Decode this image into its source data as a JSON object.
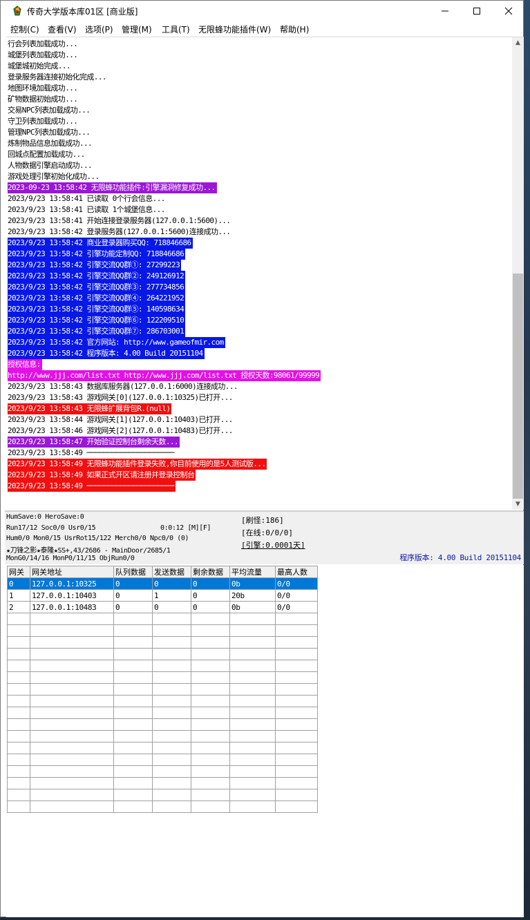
{
  "window": {
    "title": "传奇大学版本库01区 [商业版]",
    "accent": "#0078d7"
  },
  "menu": [
    "控制(C)",
    "查看(V)",
    "选项(P)",
    "管理(M)",
    "工具(T)",
    "无限蜂功能插件(W)",
    "帮助(H)"
  ],
  "log": [
    {
      "text": "行会列表加载成功...",
      "style": "normal"
    },
    {
      "text": "城堡列表加载成功...",
      "style": "normal"
    },
    {
      "text": "城堡城初始完成...",
      "style": "normal"
    },
    {
      "text": "登录服务器连接初始化完成...",
      "style": "normal"
    },
    {
      "text": "地图环境加载成功...",
      "style": "normal"
    },
    {
      "text": "矿物数据初始成功...",
      "style": "normal"
    },
    {
      "text": "交易NPC列表加载成功...",
      "style": "normal"
    },
    {
      "text": "守卫列表加载成功...",
      "style": "normal"
    },
    {
      "text": "管理NPC列表加载成功...",
      "style": "normal"
    },
    {
      "text": "炼制物品信息加载成功...",
      "style": "normal"
    },
    {
      "text": "回城点配置加载成功...",
      "style": "normal"
    },
    {
      "text": "人物数据引擎启动成功...",
      "style": "normal"
    },
    {
      "text": "游戏处理引擎初始化成功...",
      "style": "normal"
    },
    {
      "text": "2023-09-23 13:58:42 无限蜂功能插件:引擎漏洞修复成功...",
      "style": "purple"
    },
    {
      "text": "2023/9/23 13:58:41 已读取 0个行会信息...",
      "style": "normal"
    },
    {
      "text": "2023/9/23 13:58:41 已读取 1个城堡信息...",
      "style": "normal"
    },
    {
      "text": "2023/9/23 13:58:41 开始连接登录服务器(127.0.0.1:5600)...",
      "style": "normal"
    },
    {
      "text": "2023/9/23 13:58:42 登录服务器(127.0.0.1:5600)连接成功...",
      "style": "normal"
    },
    {
      "text": "2023/9/23 13:58:42 商业登录器购买QQ: 718846686",
      "style": "blue"
    },
    {
      "text": "2023/9/23 13:58:42 引擎功能定制QQ: 718846686",
      "style": "blue"
    },
    {
      "text": "2023/9/23 13:58:42 引擎交流QQ群①: 27299223",
      "style": "blue"
    },
    {
      "text": "2023/9/23 13:58:42 引擎交流QQ群②: 249126912",
      "style": "blue"
    },
    {
      "text": "2023/9/23 13:58:42 引擎交流QQ群③: 277734856",
      "style": "blue"
    },
    {
      "text": "2023/9/23 13:58:42 引擎交流QQ群④: 264221952",
      "style": "blue"
    },
    {
      "text": "2023/9/23 13:58:42 引擎交流QQ群⑤: 140598634",
      "style": "blue"
    },
    {
      "text": "2023/9/23 13:58:42 引擎交流QQ群⑥: 122209510",
      "style": "blue"
    },
    {
      "text": "2023/9/23 13:58:42 引擎交流QQ群⑦: 286703001",
      "style": "blue"
    },
    {
      "text": "2023/9/23 13:58:42 官方网站: http://www.gameofmir.com",
      "style": "blue"
    },
    {
      "text": "2023/9/23 13:58:42 程序版本: 4.00 Build 20151104",
      "style": "blue"
    },
    {
      "text": "授权信息:",
      "style": "magenta"
    },
    {
      "text": "http://www.jjj.com/list.txt http://www.jjj.com/list.txt 授权天数:98061/99999",
      "style": "magenta"
    },
    {
      "text": "2023/9/23 13:58:43 数据库服务器(127.0.0.1:6000)连接成功...",
      "style": "normal"
    },
    {
      "text": "2023/9/23 13:58:43 游戏网关[0](127.0.0.1:10325)已打开...",
      "style": "normal"
    },
    {
      "text": "2023/9/23 13:58:43 无限蜂扩展背包R.(null)",
      "style": "red"
    },
    {
      "text": "2023/9/23 13:58:44 游戏网关[1](127.0.0.1:10403)已打开...",
      "style": "normal"
    },
    {
      "text": "2023/9/23 13:58:46 游戏网关[2](127.0.0.1:10483)已打开...",
      "style": "normal"
    },
    {
      "text": "2023/9/23 13:58:47 开始验证控制台剩余天数...",
      "style": "purple"
    },
    {
      "text": "2023/9/23 13:58:49 ─────────────────────",
      "style": "normal"
    },
    {
      "text": "2023/9/23 13:58:49 无限蜂功能插件登录失败,你目前使用的是5人测试版...",
      "style": "red"
    },
    {
      "text": "2023/9/23 13:58:49 如果正式开区请注册并登录控制台",
      "style": "red"
    },
    {
      "text": "2023/9/23 13:58:49 ─────────────────────",
      "style": "red"
    }
  ],
  "status": {
    "line1": "HumSave:0 HeroSave:0",
    "line2": "Run17/12 Soc0/0 Usr0/15",
    "timer": "0:0:12 [M][F]",
    "line3": "Hum0/0 Mon0/15 UsrRot15/122 Merch0/0 Npc0/0 (0)",
    "line4": "★刀锋之影★泰隆★SS+,43/2686 - MainDoor/2685/1",
    "line5": "MonG0/14/16 MonP0/11/15 ObjRun0/0",
    "refresh": "[刷怪:186]",
    "online": "[在线:0/0/0]",
    "engine": "[引擎:0.0001天]",
    "version": "程序版本: 4.00 Build 20151104"
  },
  "gateway_table": {
    "headers": [
      "网关",
      "网关地址",
      "队列数据",
      "发送数据",
      "剩余数据",
      "平均流量",
      "最高人数"
    ],
    "rows": [
      [
        "0",
        "127.0.0.1:10325",
        "0",
        "0",
        "0",
        "0b",
        "0/0"
      ],
      [
        "1",
        "127.0.0.1:10403",
        "0",
        "1",
        "0",
        "20b",
        "0/0"
      ],
      [
        "2",
        "127.0.0.1:10483",
        "0",
        "0",
        "0",
        "0b",
        "0/0"
      ]
    ],
    "selected_row": 0
  }
}
